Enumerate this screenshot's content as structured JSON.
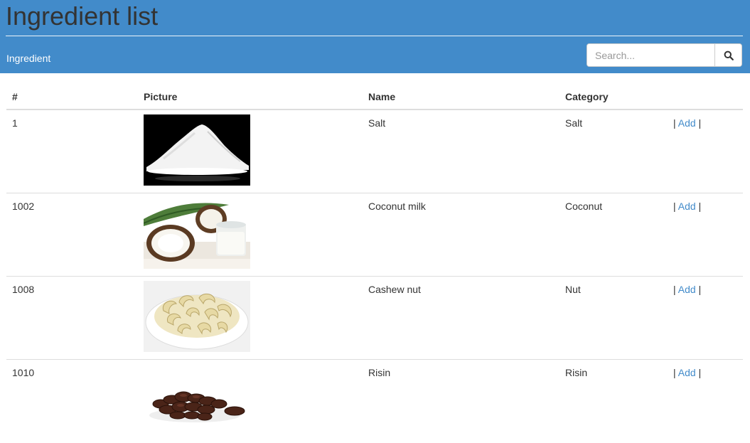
{
  "header": {
    "title": "Ingredient list",
    "section_label": "Ingredient"
  },
  "search": {
    "placeholder": "Search...",
    "button_icon": "search-icon"
  },
  "table": {
    "columns": [
      "#",
      "Picture",
      "Name",
      "Category",
      ""
    ],
    "rows": [
      {
        "id": "1",
        "name": "Salt",
        "category": "Salt",
        "picture": "salt-image",
        "action_prefix": "|",
        "action": "Add",
        "action_suffix": "|"
      },
      {
        "id": "1002",
        "name": "Coconut milk",
        "category": "Coconut",
        "picture": "coconut-milk-image",
        "action_prefix": "|",
        "action": "Add",
        "action_suffix": "|"
      },
      {
        "id": "1008",
        "name": "Cashew nut",
        "category": "Nut",
        "picture": "cashew-nut-image",
        "action_prefix": "|",
        "action": "Add",
        "action_suffix": "|"
      },
      {
        "id": "1010",
        "name": "Risin",
        "category": "Risin",
        "picture": "raisin-image",
        "action_prefix": "|",
        "action": "Add",
        "action_suffix": "|"
      }
    ]
  },
  "colors": {
    "header_bg": "#428bca",
    "link": "#428bca",
    "text": "#333333"
  }
}
